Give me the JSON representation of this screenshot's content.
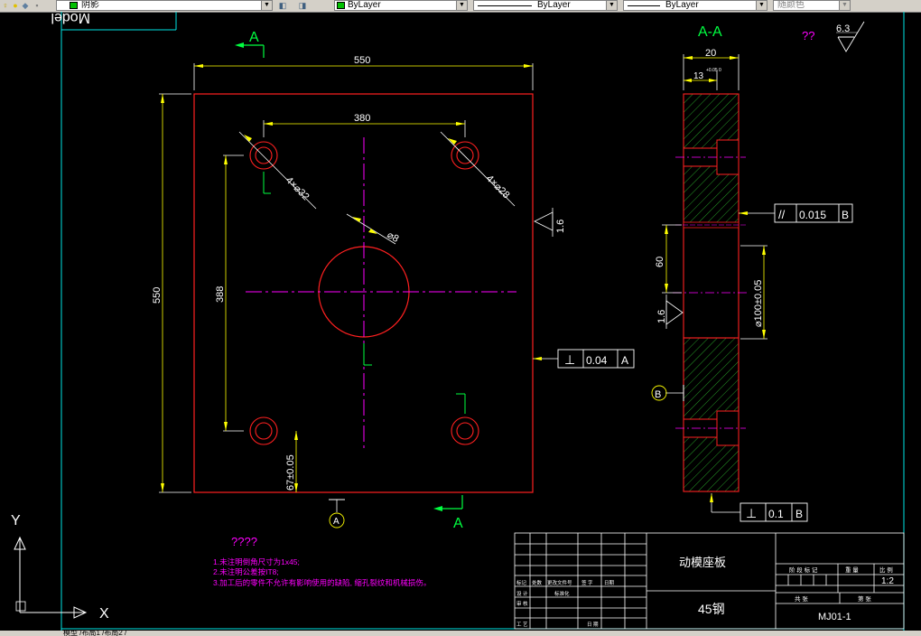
{
  "toolbar": {
    "layer_name": "阴影",
    "color_value": "ByLayer",
    "linetype_value": "ByLayer",
    "lineweight_value": "ByLayer",
    "plotstyle_value": "随颜色"
  },
  "drawing": {
    "section_label_top": "A",
    "section_label_bottom": "A",
    "section_title": "A-A",
    "unknown_top": "??",
    "roughness_general": "6.3",
    "roughness_side": "1.6",
    "roughness_section": "1.6",
    "datum_a": "A",
    "datum_b": "B",
    "dim_width": "550",
    "dim_height": "550",
    "dim_hole_x": "380",
    "dim_hole_y": "388",
    "dim_corner": "67±0.05",
    "dim_holes_left": "4×⌀32",
    "dim_holes_right": "4×⌀28",
    "dim_center_hole": "⌀8",
    "dim_thickness": "20",
    "dim_step": "13",
    "dim_step_tol": "+0.05 0",
    "dim_bore_pos": "60",
    "dim_bore_dia": "⌀100±0.05",
    "fcf_parallel": "0.015",
    "fcf_perp_main": "0.04",
    "fcf_perp_bottom": "0.1",
    "parallel_symbol": "//",
    "perp_symbol": "⊥",
    "notes_title": "????",
    "notes": [
      "1.未注明倒角尺寸为1x45;",
      "2.未注明公差按IT8;",
      "3.加工后的零件不允许有影响使用的缺陷, 缩孔裂纹和机械损伤。"
    ],
    "part_name": "动模座板",
    "material": "45钢",
    "scale": "1:2",
    "drawing_no": "MJ01-1",
    "tb_headers_right": [
      "阶 段 标 记",
      "重 量",
      "比 例"
    ],
    "tb_sheet": [
      "共 张",
      "第 张"
    ],
    "tb_left_labels": [
      "标记",
      "处数",
      "更改文件号",
      "签 字",
      "日期"
    ],
    "tb_design": [
      "设 计",
      "标准化"
    ],
    "tb_review": "审 核",
    "tb_craft": "工 艺",
    "tb_date": "日 期",
    "ucs_y": "Y",
    "ucs_x": "X",
    "layout_tab_text": "Model"
  },
  "statusbar": {
    "tabs_text": "模型 /布局1 /布局2 /"
  },
  "colors": {
    "red": "#ff2020",
    "yellow": "#ffff00",
    "magenta": "#ff00ff",
    "green": "#00ff40",
    "cyan": "#00e5e5",
    "white": "#ffffff",
    "hatch": "#2fbf2f"
  }
}
